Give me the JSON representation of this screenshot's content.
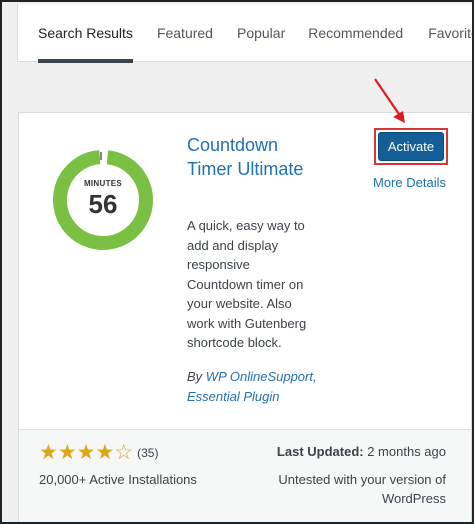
{
  "tabs": [
    {
      "label": "Search Results",
      "current": true
    },
    {
      "label": "Featured",
      "current": false
    },
    {
      "label": "Popular",
      "current": false
    },
    {
      "label": "Recommended",
      "current": false
    },
    {
      "label": "Favorites",
      "current": false
    }
  ],
  "plugin": {
    "icon": {
      "caption": "MINUTES",
      "number": "56",
      "ring_color": "#7ac143"
    },
    "title": "Countdown Timer Ultimate",
    "description": "A quick, easy way to add and display responsive Countdown timer on your website. Also work with Gutenberg shortcode block.",
    "author_prefix": "By",
    "author_name": "WP OnlineSupport, Essential Plugin",
    "activate_label": "Activate",
    "more_details_label": "More Details"
  },
  "footer": {
    "rating_stars": 4,
    "rating_max": 5,
    "rating_count": "(35)",
    "installs": "20,000+ Active Installations",
    "last_updated_label": "Last Updated:",
    "last_updated_value": "2 months ago",
    "compatibility": "Untested with your version of WordPress"
  },
  "colors": {
    "accent": "#2271b1",
    "button": "#135e96",
    "highlight": "#d63638",
    "star": "#dba617"
  },
  "icons": {
    "annotation_arrow": "arrow-pointing-down-right-icon",
    "star_filled": "star-filled-icon",
    "star_empty": "star-empty-icon"
  }
}
